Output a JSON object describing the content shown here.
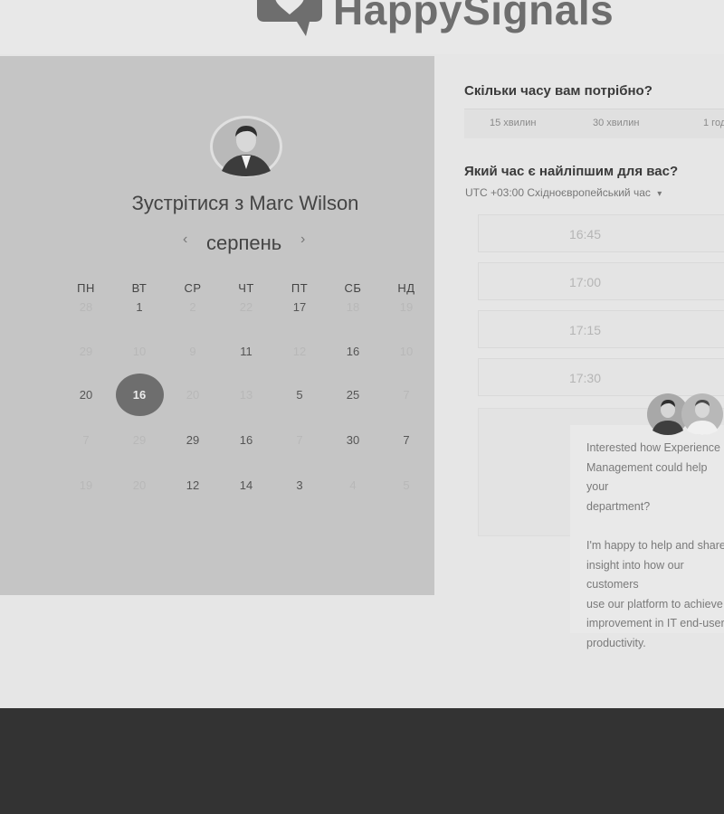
{
  "brand": {
    "name": "HappySignals"
  },
  "calendar": {
    "title": "Зустрітися з Marc Wilson",
    "month": "серпень",
    "prev_icon": "‹",
    "next_icon": "›",
    "weekdays": [
      "ПН",
      "ВТ",
      "СР",
      "ЧТ",
      "ПТ",
      "СБ",
      "НД"
    ],
    "weeks": [
      [
        "28",
        "1",
        "2",
        "22",
        "17",
        "18",
        "19"
      ],
      [
        "29",
        "10",
        "9",
        "11",
        "12",
        "16",
        "10"
      ],
      [
        "20",
        "16",
        "20",
        "13",
        "5",
        "25",
        "7"
      ],
      [
        "7",
        "29",
        "29",
        "16",
        "7",
        "30",
        "7"
      ],
      [
        "19",
        "20",
        "12",
        "14",
        "3",
        "4",
        "5"
      ]
    ],
    "selected": "16"
  },
  "duration": {
    "title": "Скільки часу вам потрібно?",
    "options": [
      "15 хвилин",
      "30 хвилин",
      "1 год"
    ]
  },
  "time": {
    "title": "Який час є найліпшим для вас?",
    "timezone": "UTC +03:00 Східноєвропейський час",
    "timezone_icon": "▾",
    "slots": [
      "16:45",
      "17:00",
      "17:15",
      "17:30"
    ]
  },
  "chat": {
    "message": "Interested how Experience\nManagement could help your\ndepartment?\n\nI'm happy to help and share\ninsight into how our customers\nuse our platform to achieve\nimprovement in IT end-user\nproductivity."
  },
  "colors": {
    "panel_bg": "#c5c5c5",
    "selected_day": "#6e6e6e",
    "footer_bg": "#333333"
  }
}
